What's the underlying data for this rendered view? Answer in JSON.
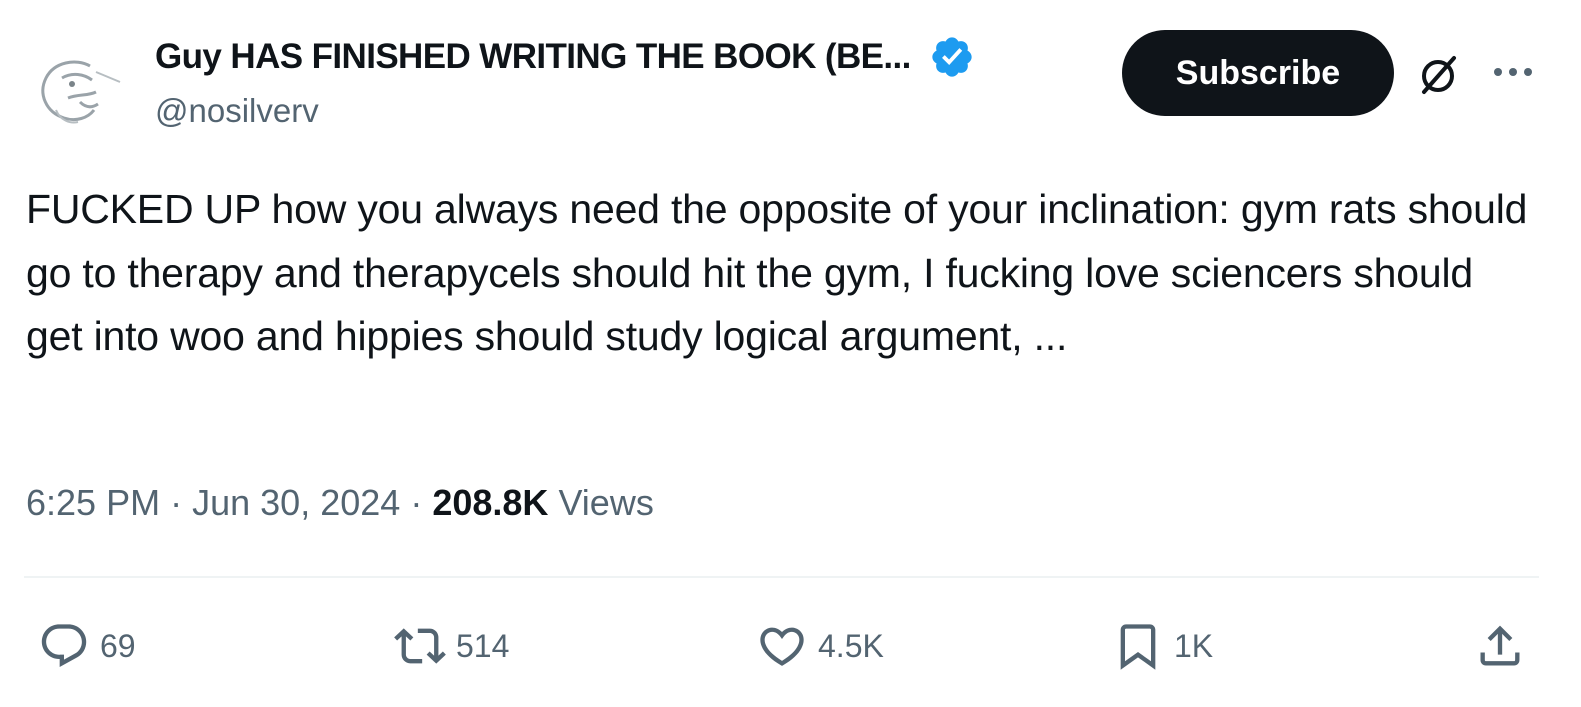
{
  "author": {
    "display_name": "Guy HAS FINISHED WRITING THE BOOK (BE...",
    "handle": "@nosilverv",
    "verified_color": "#1d9bf0",
    "avatar_icon": "hand-drawn-face-avatar"
  },
  "header": {
    "subscribe_label": "Subscribe",
    "grok_icon": "grok-icon",
    "more_icon": "more-icon"
  },
  "tweet": {
    "text": "FUCKED UP how you always need the opposite of your inclination: gym rats should go to therapy and therapycels should hit the gym, I fucking love sciencers should get into woo and hippies should study logical argument, ..."
  },
  "meta": {
    "time": "6:25 PM",
    "separator": "·",
    "date": "Jun 30, 2024",
    "views_count": "208.8K",
    "views_label": "Views"
  },
  "actions": {
    "reply_count": "69",
    "retweet_count": "514",
    "like_count": "4.5K",
    "bookmark_count": "1K"
  },
  "colors": {
    "text_primary": "#0f1419",
    "text_secondary": "#536471",
    "subscribe_bg": "#0f1419",
    "divider": "#eff3f4"
  }
}
